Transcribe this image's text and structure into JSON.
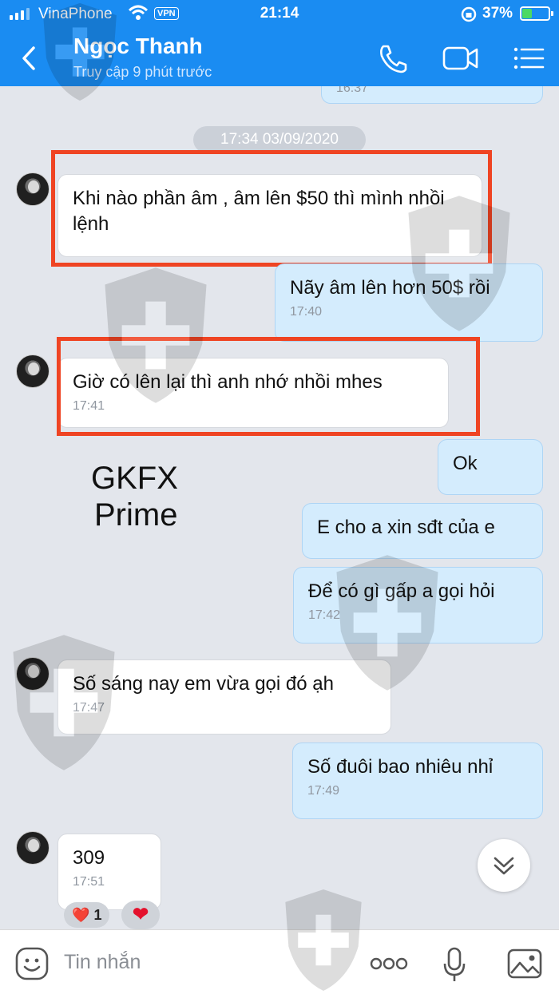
{
  "status_bar": {
    "carrier": "VinaPhone",
    "vpn": "VPN",
    "time": "21:14",
    "battery_percent": "37%",
    "battery_level": 0.37
  },
  "header": {
    "contact_name": "Ngọc Thanh",
    "contact_status": "Truy cập 9 phút trước",
    "icons": [
      "back-icon",
      "phone-icon",
      "video-camera-icon",
      "menu-icon"
    ]
  },
  "chat": {
    "partial_time": "16:37",
    "date_separator": "17:34 03/09/2020",
    "messages": [
      {
        "sender": "contact",
        "text": "Khi nào phần âm , âm lên $50 thì mình nhồi lệnh",
        "time": ""
      },
      {
        "sender": "me",
        "text": "Nãy âm lên hơn 50$ rồi",
        "time": "17:40"
      },
      {
        "sender": "contact",
        "text": "Giờ có lên lại thì anh nhớ nhồi mhes",
        "time": "17:41"
      },
      {
        "sender": "me",
        "text": "Ok",
        "time": ""
      },
      {
        "sender": "me",
        "text": "E cho a xin sđt của e",
        "time": ""
      },
      {
        "sender": "me",
        "text": "Để có gì gấp a gọi hỏi",
        "time": "17:42"
      },
      {
        "sender": "contact",
        "text": "Số sáng nay em vừa gọi đó ạh",
        "time": "17:47"
      },
      {
        "sender": "me",
        "text": "Số đuôi bao nhiêu nhỉ",
        "time": "17:49"
      },
      {
        "sender": "contact",
        "text": "309",
        "time": "17:51"
      }
    ],
    "reactions": [
      {
        "emoji": "❤️",
        "count": "1"
      },
      {
        "emoji": "❤",
        "count": ""
      }
    ],
    "caption_line1": "GKFX",
    "caption_line2": "Prime"
  },
  "input_bar": {
    "placeholder": "Tin nhắn",
    "icons": [
      "emoji-icon",
      "more-icon",
      "microphone-icon",
      "image-icon"
    ]
  },
  "colors": {
    "header": "#1a8cf2",
    "incoming_bubble": "#ffffff",
    "outgoing_bubble": "#d4ecfd",
    "highlight_box": "#ef4423",
    "background": "#e3e6ec"
  }
}
